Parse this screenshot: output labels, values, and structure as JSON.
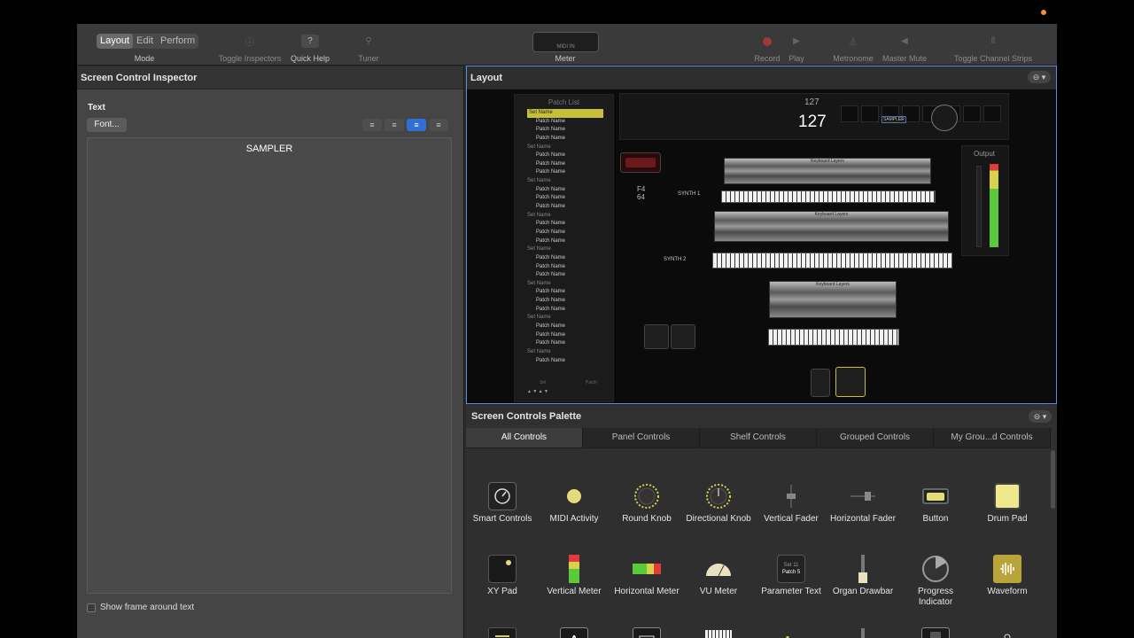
{
  "toolbar": {
    "mode_segments": [
      "Layout",
      "Edit",
      "Perform"
    ],
    "mode_label": "Mode",
    "toggle_inspectors": "Toggle Inspectors",
    "quick_help": "Quick Help",
    "tuner": "Tuner",
    "meter_display": "MIDI IN",
    "meter_label": "Meter",
    "record": "Record",
    "play": "Play",
    "metronome": "Metronome",
    "master_mute": "Master Mute",
    "toggle_channel_strips": "Toggle Channel Strips"
  },
  "inspector": {
    "title": "Screen Control Inspector",
    "section": "Text",
    "font_button": "Font...",
    "text_value": "SAMPLER",
    "checkbox_label": "Show frame around text",
    "align_icons": [
      "≡",
      "≡",
      "≡",
      "≡"
    ]
  },
  "layout": {
    "title": "Layout",
    "patch_list": {
      "title": "Patch List",
      "rows": [
        {
          "t": "set",
          "label": "Set Name",
          "sel": true
        },
        {
          "t": "patch",
          "label": "Patch Name"
        },
        {
          "t": "patch",
          "label": "Patch Name"
        },
        {
          "t": "patch",
          "label": "Patch Name"
        },
        {
          "t": "set",
          "label": "Set Name"
        },
        {
          "t": "patch",
          "label": "Patch Name"
        },
        {
          "t": "patch",
          "label": "Patch Name"
        },
        {
          "t": "patch",
          "label": "Patch Name"
        },
        {
          "t": "set",
          "label": "Set Name"
        },
        {
          "t": "patch",
          "label": "Patch Name"
        },
        {
          "t": "patch",
          "label": "Patch Name"
        },
        {
          "t": "patch",
          "label": "Patch Name"
        },
        {
          "t": "set",
          "label": "Set Name"
        },
        {
          "t": "patch",
          "label": "Patch Name"
        },
        {
          "t": "patch",
          "label": "Patch Name"
        },
        {
          "t": "patch",
          "label": "Patch Name"
        },
        {
          "t": "set",
          "label": "Set Name"
        },
        {
          "t": "patch",
          "label": "Patch Name"
        },
        {
          "t": "patch",
          "label": "Patch Name"
        },
        {
          "t": "patch",
          "label": "Patch Name"
        },
        {
          "t": "set",
          "label": "Set Name"
        },
        {
          "t": "patch",
          "label": "Patch Name"
        },
        {
          "t": "patch",
          "label": "Patch Name"
        },
        {
          "t": "patch",
          "label": "Patch Name"
        },
        {
          "t": "set",
          "label": "Set Name"
        },
        {
          "t": "patch",
          "label": "Patch Name"
        },
        {
          "t": "patch",
          "label": "Patch Name"
        },
        {
          "t": "patch",
          "label": "Patch Name"
        },
        {
          "t": "set",
          "label": "Set Name"
        },
        {
          "t": "patch",
          "label": "Patch Name"
        }
      ],
      "ctrl_set": "Set",
      "ctrl_patch": "Patch"
    },
    "parameter_small": "127",
    "parameter_big": "127",
    "sampler_tag": "SAMPLER",
    "note_name": "F4",
    "note_velocity": "64",
    "synth1": "SYNTH 1",
    "synth2": "SYNTH 2",
    "keyboard_layers": "Keyboard Layers",
    "output": "Output"
  },
  "palette": {
    "title": "Screen Controls Palette",
    "tabs": [
      "All Controls",
      "Panel Controls",
      "Shelf Controls",
      "Grouped Controls",
      "My Grou...d Controls"
    ],
    "row1": [
      "Smart Controls",
      "MIDI Activity",
      "Round Knob",
      "Directional Knob",
      "Vertical Fader",
      "Horizontal Fader",
      "Button",
      "Drum Pad"
    ],
    "row2": [
      "XY Pad",
      "Vertical Meter",
      "Horizontal Meter",
      "VU Meter",
      "Parameter Text",
      "Organ Drawbar",
      "Progress Indicator",
      "Waveform"
    ],
    "param_text_icon": [
      "Set 11",
      "Patch 5"
    ],
    "text_icon_letter": "A"
  },
  "colors": {
    "accent": "#2f6fd6",
    "selection": "#c6c038",
    "record": "#e03b3b",
    "notification": "#f2912d"
  }
}
